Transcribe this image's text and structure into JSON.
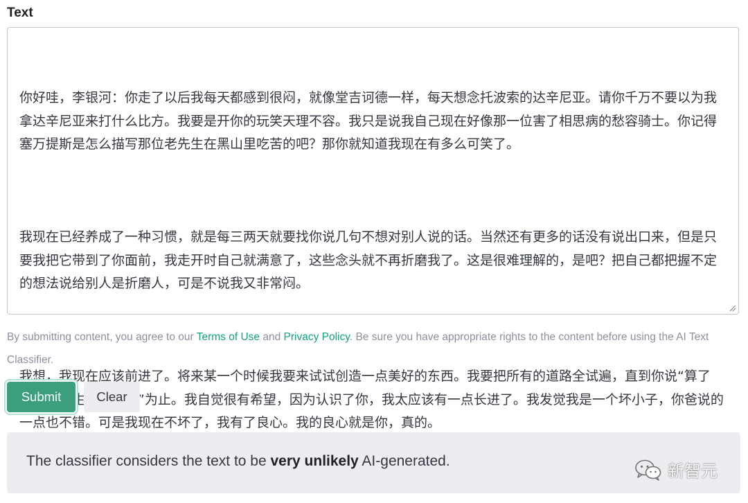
{
  "form": {
    "label": "Text",
    "paragraphs": [
      "你好哇，李银河：你走了以后我每天都感到很闷，就像堂吉诃德一样，每天想念托波索的达辛尼亚。请你千万不要以为我拿达辛尼亚来打什么比方。我要是开你的玩笑天理不容。我只是说我自己现在好像那一位害了相思病的愁容骑士。你记得塞万提斯是怎么描写那位老先生在黑山里吃苦的吧？那你就知道我现在有多么可笑了。",
      "我现在已经养成了一种习惯，就是每三两天就要找你说几句不想对别人说的话。当然还有更多的话没有说出口来，但是只要我把它带到了你面前，我走开时自己就满意了，这些念头就不再折磨我了。这是很难理解的，是吧？把自己都把握不定的想法说给别人是折磨人，可是不说我又非常闷。",
      "我想，我现在应该前进了。将来某一个时候我要来试试创造一点美好的东西。我要把所有的道路全试遍，直到你说“算了吧，王先生，你不成”为止。我自觉很有希望，因为认识了你，我太应该有一点长进了。我发觉我是一个坏小子，你爸说的一点也不错。可是我现在不坏了，我有了良心。我的良心就是你，真的。"
    ]
  },
  "disclaimer": {
    "prefix": "By submitting content, you agree to our ",
    "terms": "Terms of Use",
    "and": " and ",
    "privacy": "Privacy Policy",
    "suffix": ". Be sure you have appropriate rights to the content before using the AI Text Classifier."
  },
  "buttons": {
    "submit": "Submit",
    "clear": "Clear"
  },
  "result": {
    "prefix": "The classifier considers the text to be ",
    "verdict": "very unlikely",
    "suffix": " AI-generated."
  },
  "watermark": {
    "text": "新智元",
    "icon": "wechat-icon"
  },
  "colors": {
    "accent": "#10a37f",
    "submit_bg": "#3b9e7e",
    "result_bg": "#ececf1"
  }
}
